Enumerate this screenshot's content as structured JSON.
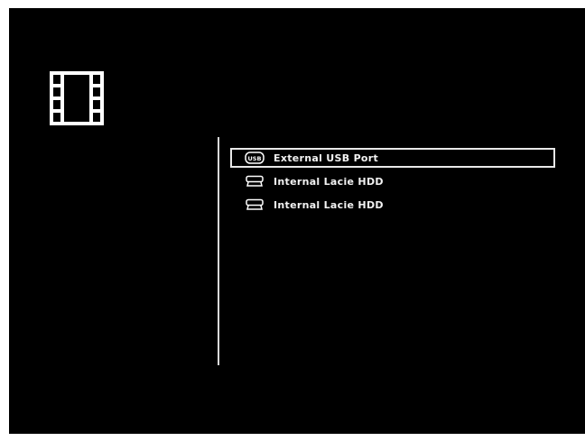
{
  "section": {
    "icon": "film-strip-icon"
  },
  "devices": [
    {
      "label": "External USB Port",
      "icon": "usb-icon",
      "selected": true
    },
    {
      "label": "Internal Lacie HDD",
      "icon": "hard-drive-icon",
      "selected": false
    },
    {
      "label": "Internal Lacie HDD",
      "icon": "hard-drive-icon",
      "selected": false
    }
  ],
  "colors": {
    "background": "#000000",
    "text": "#f2f2f2",
    "highlight_border": "#e8e8e8",
    "divider": "#d9d9d9"
  }
}
